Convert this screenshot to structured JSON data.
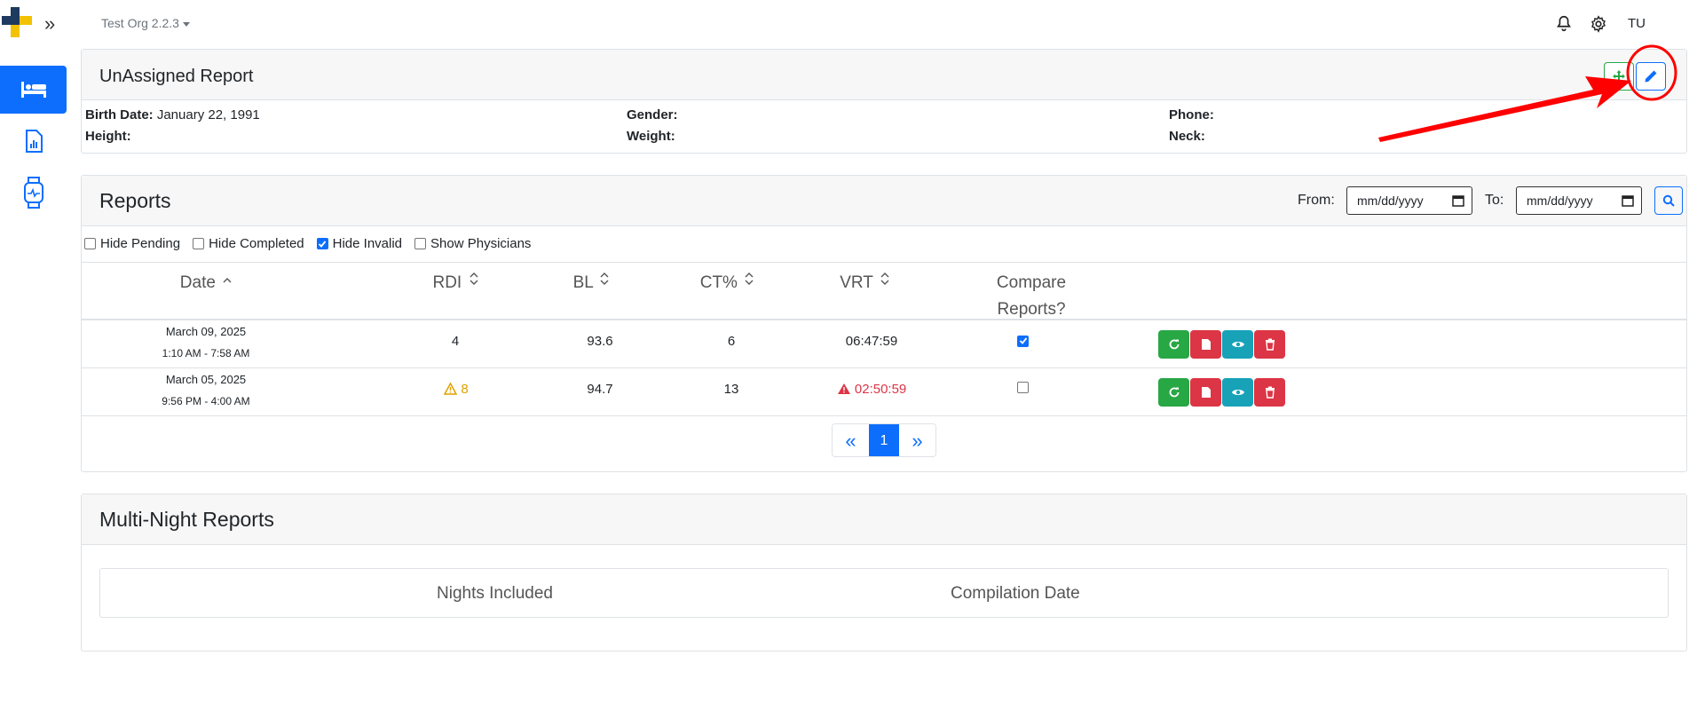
{
  "header": {
    "org_name": "Test Org 2.2.3",
    "user_initials": "TU",
    "icons": [
      "logo-cross-icon",
      "expand-icon",
      "bell-icon",
      "gear-icon"
    ]
  },
  "sidebar": {
    "items": [
      {
        "icon": "bed-icon",
        "active": true
      },
      {
        "icon": "report-chart-icon",
        "active": false
      },
      {
        "icon": "watch-device-icon",
        "active": false
      }
    ]
  },
  "patient": {
    "title": "UnAssigned Report",
    "birth_date_label": "Birth Date:",
    "birth_date": "January 22, 1991",
    "gender_label": "Gender:",
    "gender": "",
    "phone_label": "Phone:",
    "phone": "",
    "height_label": "Height:",
    "height": "",
    "weight_label": "Weight:",
    "weight": "",
    "neck_label": "Neck:",
    "neck": ""
  },
  "reports": {
    "title": "Reports",
    "from_label": "From:",
    "to_label": "To:",
    "date_placeholder": "mm/dd/yyyy",
    "filters": [
      {
        "label": "Hide Pending",
        "checked": false
      },
      {
        "label": "Hide Completed",
        "checked": false
      },
      {
        "label": "Hide Invalid",
        "checked": true
      },
      {
        "label": "Show Physicians",
        "checked": false
      }
    ],
    "columns": {
      "date": "Date",
      "rdi": "RDI",
      "bl": "BL",
      "ct": "CT%",
      "vrt": "VRT",
      "compare_1": "Compare",
      "compare_2": "Reports?"
    },
    "rows": [
      {
        "date": "March 09, 2025",
        "time": "1:10 AM - 7:58 AM",
        "rdi": "4",
        "rdi_warning": false,
        "bl": "93.6",
        "ct": "6",
        "vrt": "06:47:59",
        "vrt_alert": false,
        "compare": true
      },
      {
        "date": "March 05, 2025",
        "time": "9:56 PM - 4:00 AM",
        "rdi": "8",
        "rdi_warning": true,
        "bl": "94.7",
        "ct": "13",
        "vrt": "02:50:59",
        "vrt_alert": true,
        "compare": false
      }
    ],
    "pagination": {
      "current": "1"
    }
  },
  "multi_night": {
    "title": "Multi-Night Reports",
    "columns": {
      "nights": "Nights Included",
      "compilation": "Compilation Date"
    }
  },
  "colors": {
    "primary": "#0d6efd",
    "success": "#28a745",
    "danger": "#dc3545",
    "info": "#17a2b8",
    "warning": "#e0a100",
    "annotation": "#ff0000"
  }
}
